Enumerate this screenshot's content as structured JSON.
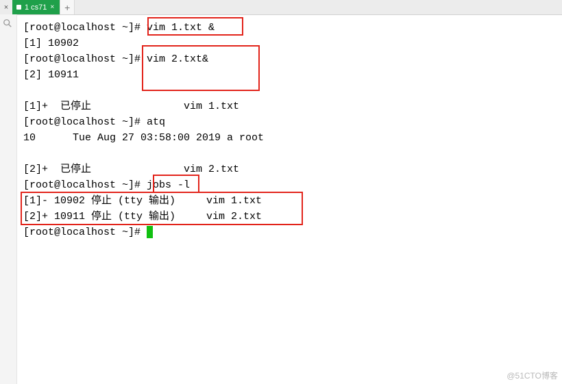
{
  "tabbar": {
    "close_x": "×",
    "tab_label": "1 cs71",
    "tab_close_x": "×",
    "new_tab": "+"
  },
  "terminal": {
    "lines": {
      "l01a": "[root@localhost ~]# ",
      "l01b": "vim 1.txt &",
      "l02": "[1] 10902",
      "l03a": "[root@localhost ~]",
      "l03b": "# vim 2.txt&",
      "l04": "[2] 10911",
      "l05": "",
      "l06": "[1]+  已停止               vim 1.txt",
      "l07": "[root@localhost ~]# atq",
      "l08": "10      Tue Aug 27 03:58:00 2019 a root",
      "l09": "",
      "l10": "[2]+  已停止               vim 2.txt",
      "l11a": "[root@localhost ~]# ",
      "l11b": "jobs -l",
      "l12": "[1]- 10902 停止 (tty 输出)     vim 1.txt",
      "l13": "[2]+ 10911 停止 (tty 输出)     vim 2.txt",
      "l14": "[root@localhost ~]# "
    }
  },
  "watermark": "@51CTO博客"
}
